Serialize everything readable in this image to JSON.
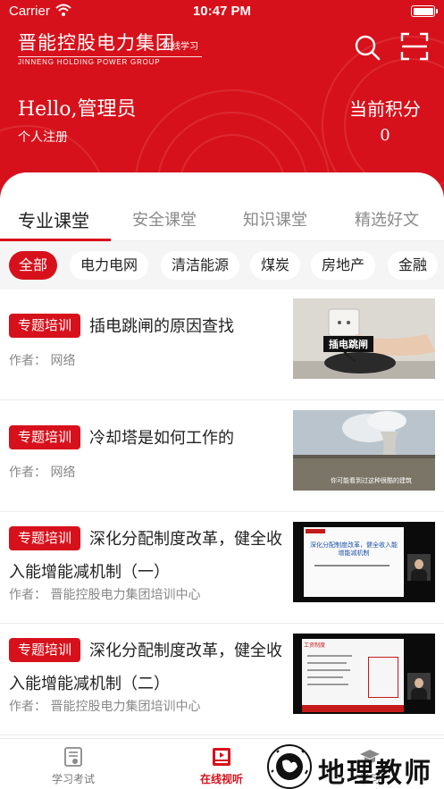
{
  "status_bar": {
    "carrier": "Carrier",
    "time": "10:47 PM"
  },
  "header": {
    "logo_title": "晋能控股电力集团",
    "logo_tag": "在线学习",
    "logo_subtitle": "JINNENG HOLDING POWER GROUP",
    "greeting": "Hello,管理员",
    "register_link": "个人注册",
    "points_label": "当前积分",
    "points_value": "0"
  },
  "tabs": [
    {
      "label": "专业课堂",
      "active": true
    },
    {
      "label": "安全课堂",
      "active": false
    },
    {
      "label": "知识课堂",
      "active": false
    },
    {
      "label": "精选好文",
      "active": false
    }
  ],
  "chips": [
    {
      "label": "全部",
      "active": true
    },
    {
      "label": "电力电网",
      "active": false
    },
    {
      "label": "清洁能源",
      "active": false
    },
    {
      "label": "煤炭",
      "active": false
    },
    {
      "label": "房地产",
      "active": false
    },
    {
      "label": "金融",
      "active": false
    }
  ],
  "courses": [
    {
      "badge": "专题培训",
      "title": "插电跳闸的原因查找",
      "author": "作者：  网络",
      "thumb_caption": "插电跳闸"
    },
    {
      "badge": "专题培训",
      "title": "冷却塔是如何工作的",
      "author": "作者：  网络",
      "thumb_caption": "你可能看到过这种很酷的建筑"
    },
    {
      "badge": "专题培训",
      "title": "深化分配制度改革，健全收入能增能减机制（一）",
      "author": "作者：  晋能控股电力集团培训中心",
      "thumb_caption": "深化分配制度改革，健全收入能增能减机制"
    },
    {
      "badge": "专题培训",
      "title": "深化分配制度改革，健全收入能增能减机制（二）",
      "author": "作者：  晋能控股电力集团培训中心",
      "thumb_caption": "工资制度"
    }
  ],
  "tabbar": [
    {
      "label": "学习考试",
      "icon": "exam-icon",
      "active": false
    },
    {
      "label": "在线视听",
      "icon": "video-icon",
      "active": true
    },
    {
      "label": "学习",
      "icon": "graduation-icon",
      "active": false
    }
  ],
  "watermark": {
    "text": "地理教师"
  },
  "colors": {
    "brand_red": "#d7111b",
    "page_bg": "#ffffff",
    "chip_bar_bg": "#f5f5f5"
  }
}
